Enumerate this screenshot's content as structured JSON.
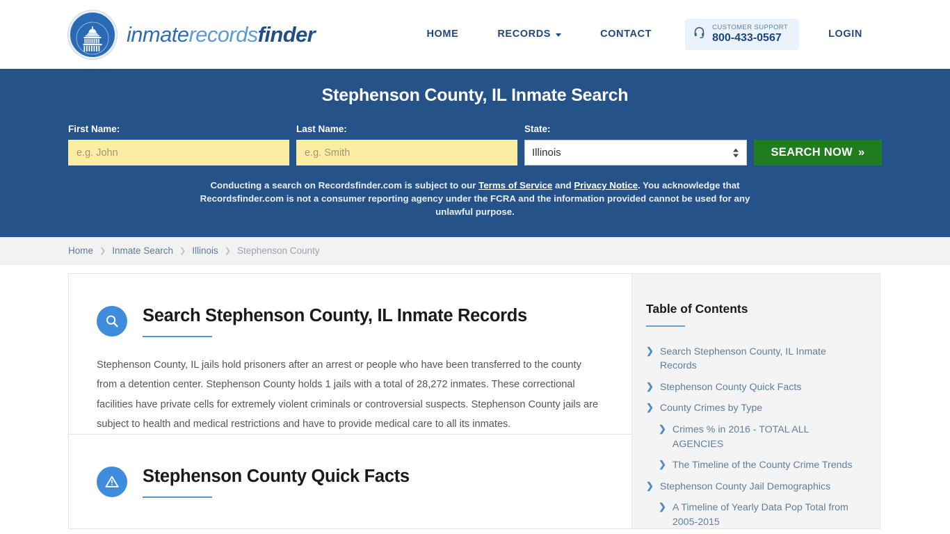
{
  "header": {
    "brand": {
      "part1": "inmate",
      "part2": "records",
      "part3": "finder",
      "logo_icon": "capitol-dome-icon"
    },
    "nav": [
      {
        "label": "HOME",
        "name": "nav-home"
      },
      {
        "label": "RECORDS",
        "name": "nav-records",
        "has_caret": true
      },
      {
        "label": "CONTACT",
        "name": "nav-contact"
      }
    ],
    "support": {
      "icon": "headset-icon",
      "label": "CUSTOMER SUPPORT",
      "phone": "800-433-0567"
    },
    "login_label": "LOGIN"
  },
  "hero": {
    "bg_color": "#255288",
    "title": "Stephenson County, IL Inmate Search",
    "first_name": {
      "label": "First Name:",
      "placeholder": "e.g. John",
      "value": ""
    },
    "last_name": {
      "label": "Last Name:",
      "placeholder": "e.g. Smith",
      "value": ""
    },
    "state": {
      "label": "State:",
      "value": "Illinois",
      "options": [
        "Illinois"
      ]
    },
    "search_button": "SEARCH NOW",
    "search_button_chevron": "»",
    "search_button_color": "#1f7d1f",
    "disclaimer": {
      "part1": "Conducting a search on Recordsfinder.com is subject to our ",
      "link1": "Terms of Service",
      "part2": " and ",
      "link2": "Privacy Notice",
      "part3": ". You acknowledge that Recordsfinder.com is not a consumer reporting agency under the FCRA and the information provided cannot be used for any unlawful purpose."
    }
  },
  "breadcrumb": {
    "separator": "❯",
    "items": [
      {
        "label": "Home",
        "current": false
      },
      {
        "label": "Inmate Search",
        "current": false
      },
      {
        "label": "Illinois",
        "current": false
      },
      {
        "label": "Stephenson County",
        "current": true
      }
    ]
  },
  "main": {
    "sections": [
      {
        "icon": "search-icon",
        "title": "Search Stephenson County, IL Inmate Records",
        "body": "Stephenson County, IL jails hold prisoners after an arrest or people who have been transferred to the county from a detention center. Stephenson County holds 1 jails with a total of 28,272 inmates. These correctional facilities have private cells for extremely violent criminals or controversial suspects. Stephenson County jails are subject to health and medical restrictions and have to provide medical care to all its inmates."
      },
      {
        "icon": "warning-icon",
        "title": "Stephenson County Quick Facts",
        "body": ""
      }
    ]
  },
  "toc": {
    "title": "Table of Contents",
    "chevron": "❯",
    "items": [
      {
        "label": "Search Stephenson County, IL Inmate Records",
        "sub": false
      },
      {
        "label": "Stephenson County Quick Facts",
        "sub": false
      },
      {
        "label": "County Crimes by Type",
        "sub": false
      },
      {
        "label": "Crimes % in 2016 - TOTAL ALL AGENCIES",
        "sub": true
      },
      {
        "label": "The Timeline of the County Crime Trends",
        "sub": true
      },
      {
        "label": "Stephenson County Jail Demographics",
        "sub": false
      },
      {
        "label": "A Timeline of Yearly Data Pop Total from 2005-2015",
        "sub": true
      }
    ]
  }
}
